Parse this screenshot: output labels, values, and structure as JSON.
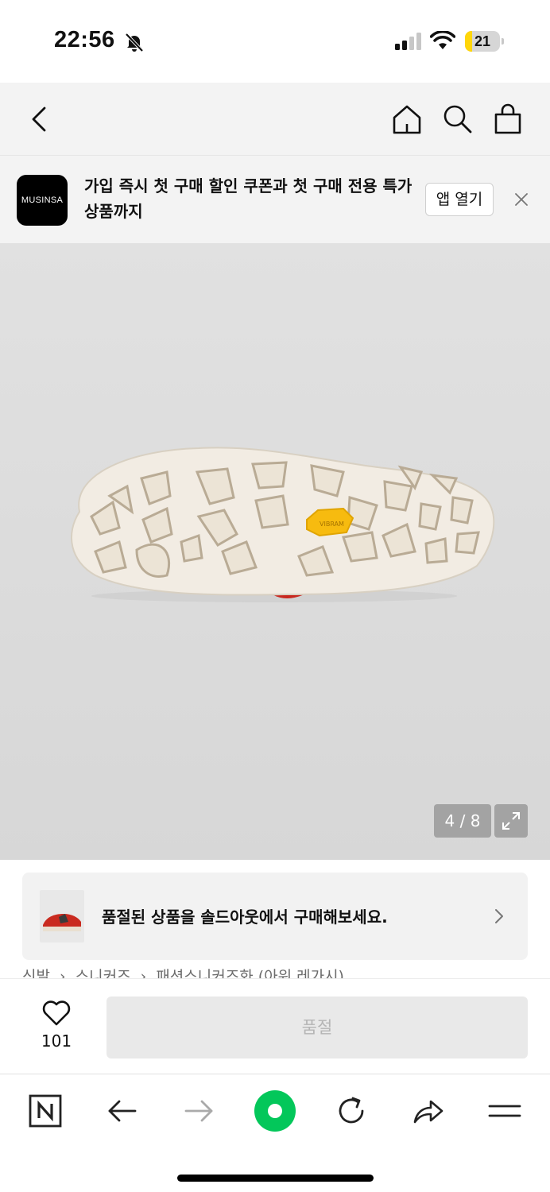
{
  "status_bar": {
    "time": "22:56",
    "battery_level": "21",
    "battery_fraction": 0.21,
    "icons": [
      "bell-slash-icon",
      "cellular-signal-icon",
      "wifi-icon",
      "battery-icon"
    ]
  },
  "nav": {
    "icons": [
      "back-chevron-icon",
      "home-icon",
      "search-icon",
      "shopping-bag-icon"
    ]
  },
  "app_banner": {
    "logo_text": "MUSINSA",
    "message": "가입 즉시 첫 구매 할인 쿠폰과 첫 구매 전용 특가 상품까지",
    "open_button_label": "앱 열기",
    "close_icon": "close-icon"
  },
  "product_gallery": {
    "page_counter": "4 / 8",
    "current_page": 4,
    "total_pages": 8,
    "expand_icon": "expand-icon",
    "image": "shoe-sole-image",
    "colors": {
      "sole": "#f2ece3",
      "outline": "#b9ab95",
      "badge": "#f7bb0f"
    }
  },
  "soldout_banner": {
    "text": "품절된 상품을 솔드아웃에서 구매해보세요.",
    "thumb_icon": "red-sneaker-thumbnail",
    "chevron_icon": "chevron-right-icon"
  },
  "breadcrumb": {
    "items": [
      "신발",
      "스니커즈",
      "패션스니커즈화 (아워 레가시)"
    ],
    "separator": "›"
  },
  "action_bar": {
    "like_icon": "heart-icon",
    "like_count": "101",
    "soldout_label": "품절"
  },
  "browser_toolbar": {
    "icons": [
      "naver-n-icon",
      "back-arrow-icon",
      "forward-arrow-icon",
      "green-record-icon",
      "refresh-icon",
      "share-icon",
      "menu-icon"
    ],
    "colors": {
      "green": "#03c75a",
      "disabled": "#aaaaaa"
    }
  }
}
